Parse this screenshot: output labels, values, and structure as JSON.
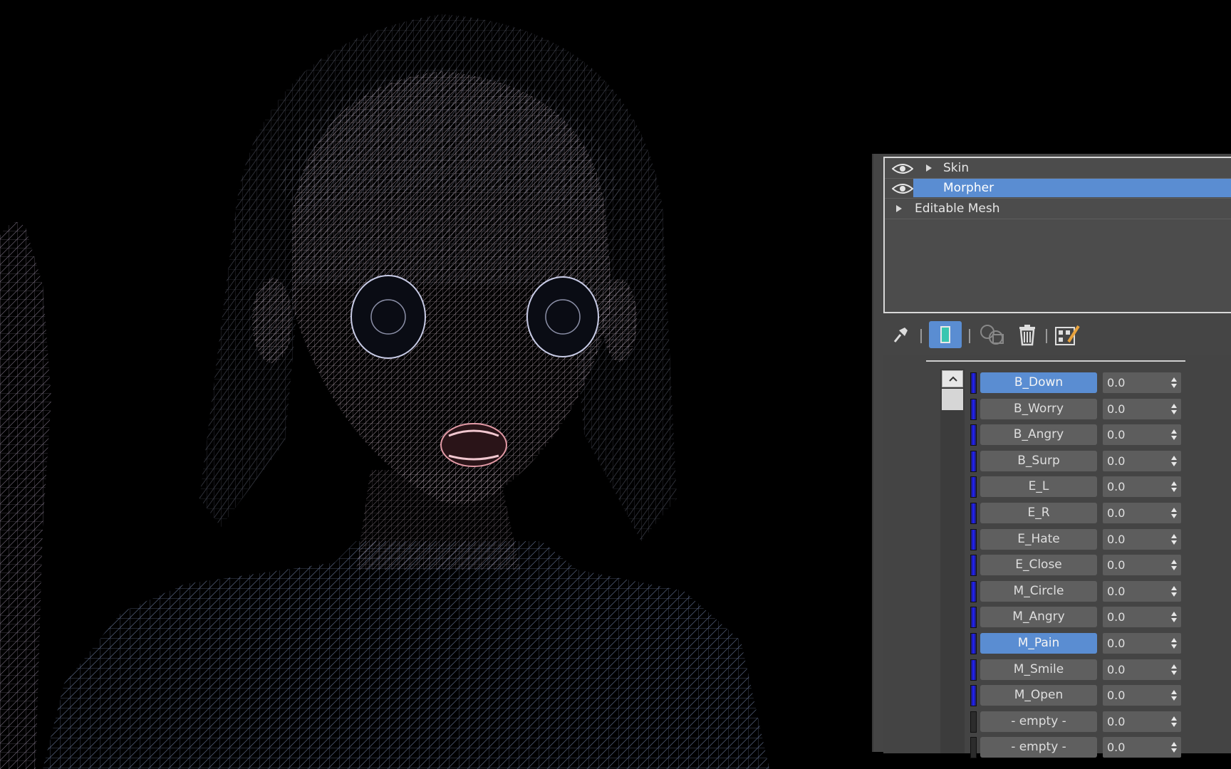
{
  "modifier_stack": {
    "items": [
      {
        "label": "Skin",
        "visible_icon": "eye-icon",
        "expand_icon": "triangle-right-icon",
        "selected": false
      },
      {
        "label": "Morpher",
        "visible_icon": "eye-icon",
        "expand_icon": "",
        "selected": true
      },
      {
        "label": "Editable Mesh",
        "visible_icon": "",
        "expand_icon": "triangle-right-icon",
        "selected": false
      }
    ]
  },
  "toolbar": {
    "buttons": [
      {
        "icon": "pin-stack-icon",
        "active": false
      },
      {
        "icon": "show-end-result-icon",
        "active": true
      },
      {
        "icon": "make-unique-icon",
        "active": false
      },
      {
        "icon": "remove-modifier-icon",
        "active": false
      },
      {
        "icon": "configure-modifier-sets-icon",
        "active": false
      }
    ]
  },
  "morpher": {
    "channels": [
      {
        "label": "B_Down",
        "value": "0.0",
        "active": true,
        "swatch": "blue"
      },
      {
        "label": "B_Worry",
        "value": "0.0",
        "active": false,
        "swatch": "blue"
      },
      {
        "label": "B_Angry",
        "value": "0.0",
        "active": false,
        "swatch": "blue"
      },
      {
        "label": "B_Surp",
        "value": "0.0",
        "active": false,
        "swatch": "blue"
      },
      {
        "label": "E_L",
        "value": "0.0",
        "active": false,
        "swatch": "blue"
      },
      {
        "label": "E_R",
        "value": "0.0",
        "active": false,
        "swatch": "blue"
      },
      {
        "label": "E_Hate",
        "value": "0.0",
        "active": false,
        "swatch": "blue"
      },
      {
        "label": "E_Close",
        "value": "0.0",
        "active": false,
        "swatch": "blue"
      },
      {
        "label": "M_Circle",
        "value": "0.0",
        "active": false,
        "swatch": "blue"
      },
      {
        "label": "M_Angry",
        "value": "0.0",
        "active": false,
        "swatch": "blue"
      },
      {
        "label": "M_Pain",
        "value": "0.0",
        "active": true,
        "swatch": "blue"
      },
      {
        "label": "M_Smile",
        "value": "0.0",
        "active": false,
        "swatch": "blue"
      },
      {
        "label": "M_Open",
        "value": "0.0",
        "active": false,
        "swatch": "blue"
      },
      {
        "label": "- empty -",
        "value": "0.0",
        "active": false,
        "swatch": "empty"
      },
      {
        "label": "- empty -",
        "value": "0.0",
        "active": false,
        "swatch": "empty"
      }
    ]
  },
  "colors": {
    "selection": "#5a8dd2",
    "panel_bg": "#454545",
    "channel_swatch": "#2020e8",
    "wire_face": "#d8c6d0",
    "wire_body": "#8fa2c8"
  }
}
